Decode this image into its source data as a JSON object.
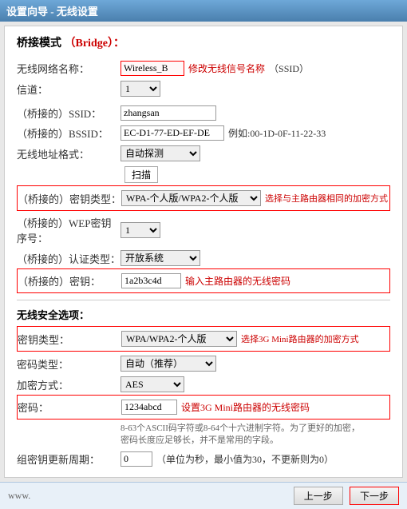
{
  "title_bar": {
    "text": "设置向导 - 无线设置"
  },
  "section": {
    "mode_label": "桥接模式",
    "bridge_label": "（Bridge）："
  },
  "fields": {
    "ssid_label": "无线网络名称：",
    "ssid_value": "Wireless_B",
    "ssid_hint": "修改无线信号名称",
    "ssid_suffix": "（SSID）",
    "channel_label": "信道：",
    "channel_value": "1",
    "bridged_ssid_label": "（桥接的）SSID：",
    "bridged_ssid_value": "zhangsan",
    "bridged_bssid_label": "（桥接的）BSSID：",
    "bridged_bssid_value": "EC-D1-77-ED-EF-DE",
    "bridged_bssid_hint": "例如:00-1D-0F-11-22-33",
    "wireless_addr_label": "无线地址格式：",
    "wireless_addr_value": "自动探测",
    "scan_btn": "扫描",
    "encrypt_type_label": "（桥接的）密钥类型：",
    "encrypt_type_value": "WPA-个人版/WPA2-个人版",
    "encrypt_hint": "选择与主路由器相同的加密方式",
    "wep_key_label": "（桥接的）WEP密钥序号：",
    "wep_key_value": "1",
    "auth_type_label": "（桥接的）认证类型：",
    "auth_type_value": "开放系统",
    "password_label": "（桥接的）密钥：",
    "password_value": "1a2b3c4d",
    "password_hint": "输入主路由器的无线密码"
  },
  "security_section": {
    "title": "无线安全选项：",
    "key_type_label": "密钥类型：",
    "key_type_value": "WPA/WPA2-个人版",
    "key_type_hint": "选择3G Mini路由器的加密方式",
    "cipher_type_label": "密码类型：",
    "cipher_type_value": "自动（推荐）",
    "encrypt_method_label": "加密方式：",
    "encrypt_method_value": "AES",
    "password_label": "密码：",
    "password_value": "1234abcd",
    "password_hint": "设置3G Mini路由器的无线密码",
    "hint_line1": "8-63个ASCII码字符或8-64个十六进制字符。为了更好的加密，",
    "hint_line2": "密码长度应足够长，并不是常用的字段。",
    "group_key_label": "组密钥更新周期：",
    "group_key_value": "0",
    "group_key_hint": "（单位为秒，最小值为30，不更新则为0）"
  },
  "footer": {
    "website": "www.",
    "prev_btn": "上一步",
    "next_btn": "下一步"
  }
}
